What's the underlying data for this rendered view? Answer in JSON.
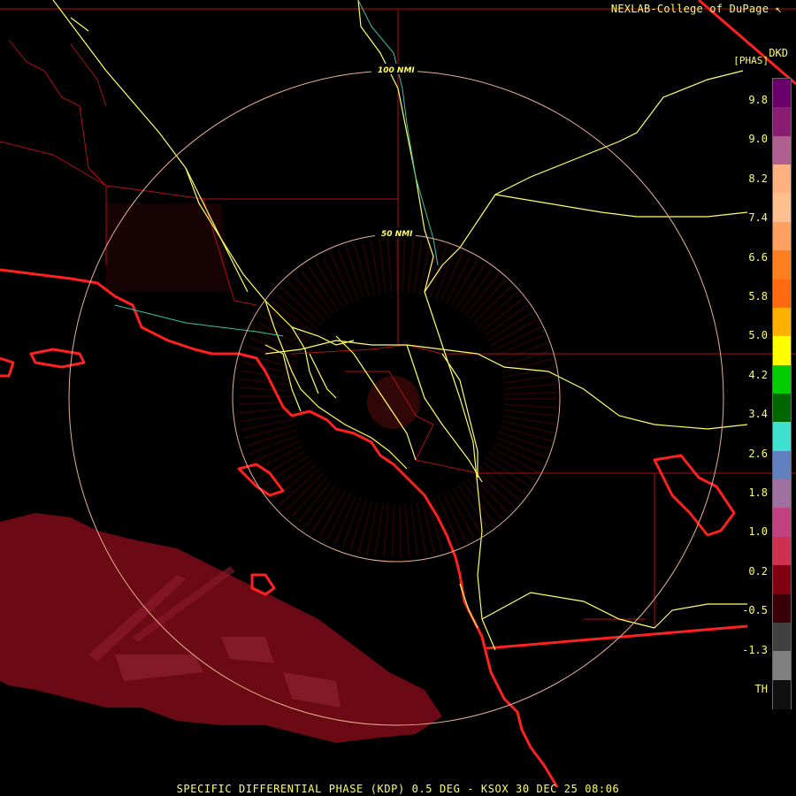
{
  "credit": "NEXLAB-College of DuPage",
  "product_code": "DKD",
  "product_unit": "[PHAS]",
  "footer": "SPECIFIC DIFFERENTIAL PHASE (KDP) 0.5 DEG - KSOX 30 DEC 25 08:06",
  "range_rings": [
    {
      "label": "50 NMI",
      "range_nmi": 50
    },
    {
      "label": "100 NMI",
      "range_nmi": 100
    }
  ],
  "colorbar": {
    "ticks": [
      "9.8",
      "9.0",
      "8.2",
      "7.4",
      "6.6",
      "5.8",
      "5.0",
      "4.2",
      "3.4",
      "2.6",
      "1.8",
      "1.0",
      "0.2",
      "-0.5",
      "-1.3",
      "TH"
    ],
    "colors": [
      "#6a006a",
      "#8a1c72",
      "#b06090",
      "#ffb080",
      "#ffc090",
      "#ffa060",
      "#ff7f20",
      "#ff6a10",
      "#ffb000",
      "#ffff00",
      "#00cc00",
      "#006600",
      "#40e0d0",
      "#6080c0",
      "#a070a0",
      "#c04080",
      "#d03050",
      "#800010",
      "#3a0008",
      "#404040",
      "#808080",
      "#101010"
    ],
    "colors_note": ""
  },
  "colors": {
    "coastline": "#ff2020",
    "highways": "#ffff66",
    "county_lines": "#b01010",
    "range_rings": "#e8b090",
    "echo": "#7a0a12"
  },
  "icons": {
    "credit_icon": "arrow-icon"
  }
}
